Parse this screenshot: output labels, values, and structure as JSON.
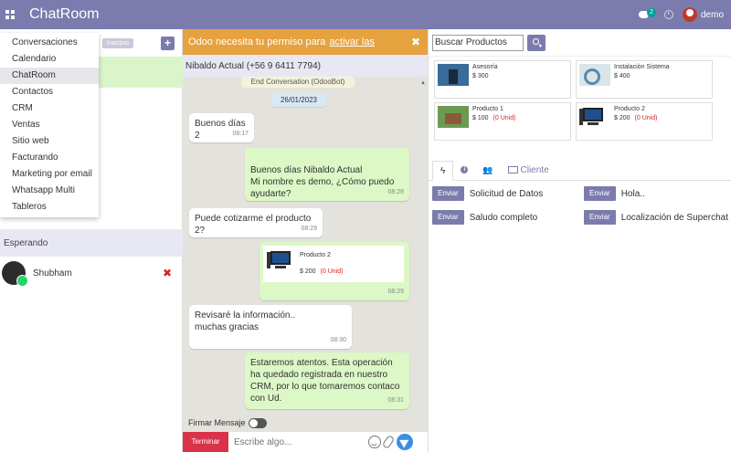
{
  "app": {
    "brand": "ChatRoom",
    "notifications_count": "2",
    "user_name": "demo"
  },
  "colors": {
    "navbar": "#7c7bad",
    "permission_bar": "#e6a23e",
    "outgoing_bubble": "#dcf8c6",
    "end_button": "#d9334a"
  },
  "menu": {
    "items": [
      {
        "label": "Conversaciones"
      },
      {
        "label": "Calendario"
      },
      {
        "label": "ChatRoom"
      },
      {
        "label": "Contactos"
      },
      {
        "label": "CRM"
      },
      {
        "label": "Ventas"
      },
      {
        "label": "Sitio web"
      },
      {
        "label": "Facturando"
      },
      {
        "label": "Marketing por email"
      },
      {
        "label": "Whatsapp Multi"
      },
      {
        "label": "Tableros"
      }
    ],
    "active": "ChatRoom"
  },
  "left": {
    "inactive_label": "Inactivo",
    "add_label": "+",
    "waiting_section": "Esperando",
    "waiting_contact": "Shubham",
    "remove_glyph": "✖"
  },
  "chat": {
    "permission_text": "Odoo necesita tu permiso para",
    "permission_link": "activar las",
    "permission_close": "✖",
    "contact_header": "Nibaldo Actual (+56 9 6411 7794)",
    "system_note": "End Conversation (OdooBot)",
    "date": "26/01/2023",
    "messages": [
      {
        "text": "Buenos días 2",
        "time": "08:17"
      },
      {
        "text": "Buenos días Nibaldo Actual\nMi nombre es demo, ¿Cómo puedo ayudarte?",
        "time": "08:28"
      },
      {
        "text": "Puede cotizarme el producto 2?",
        "time": "08:29"
      },
      {
        "product_name": "Producto 2",
        "product_price": "$ 200",
        "product_stock": "(0 Unid)",
        "time": "08:29"
      },
      {
        "text": "Revisaré la información.. muchas gracias",
        "time": "08:30"
      },
      {
        "text": "Estaremos atentos. Esta operación ha quedado registrada en nuestro CRM, por lo que tomaremos contaco con Ud.",
        "time": "08:31"
      }
    ],
    "sign_label": "Firmar Mensaje",
    "end_label": "Terminar",
    "input_placeholder": "Escribe algo..."
  },
  "right": {
    "search_value": "Buscar Productos",
    "products": [
      {
        "name": "Asesoría",
        "price": "$ 300",
        "stock": "",
        "thumb": "consulting-image"
      },
      {
        "name": "Instalación Sistema",
        "price": "$ 400",
        "stock": "",
        "thumb": "installation-image"
      },
      {
        "name": "Producto 1",
        "price": "$ 100",
        "stock": "(0 Unid)",
        "thumb": "house-image"
      },
      {
        "name": "Producto 2",
        "price": "$ 200",
        "stock": "(0 Unid)",
        "thumb": "computer-image"
      }
    ],
    "tabs": {
      "client_label": "Cliente"
    },
    "quick_replies": {
      "button_label": "Enviar",
      "items": [
        {
          "label": "Solicitud de Datos"
        },
        {
          "label": "Hola.."
        },
        {
          "label": "Saludo completo"
        },
        {
          "label": "Localización de Superchat"
        }
      ]
    }
  }
}
